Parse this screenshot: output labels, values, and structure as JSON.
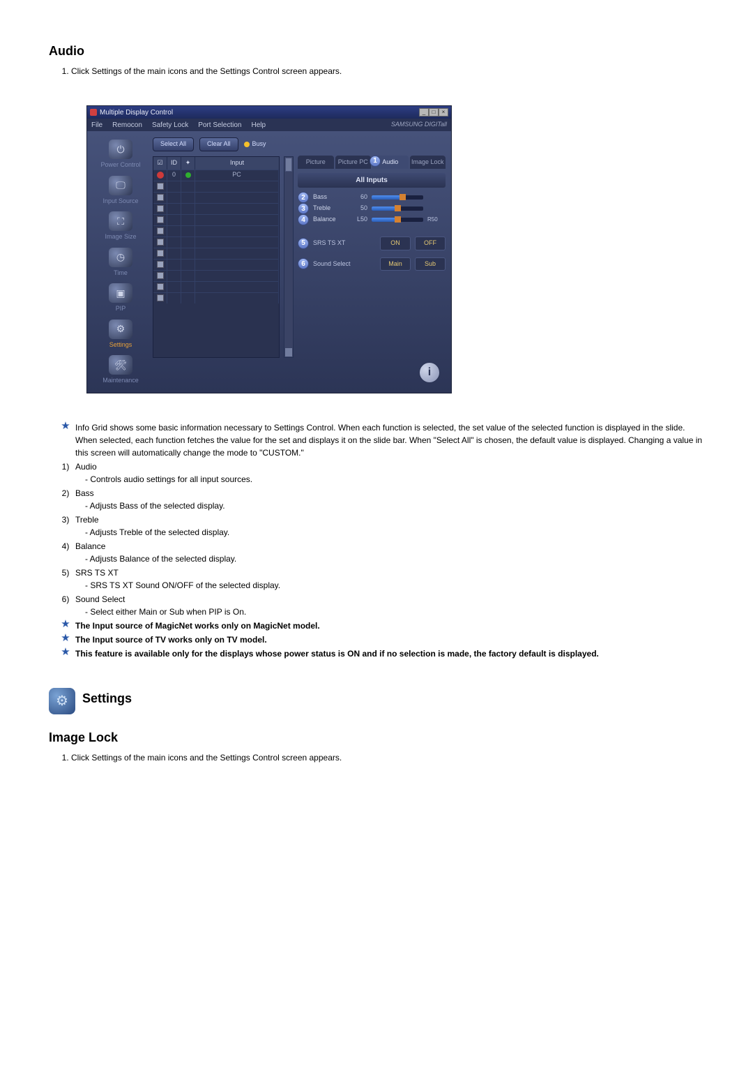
{
  "section1_title": "Audio",
  "section1_step": "Click Settings of the main icons and the Settings Control screen appears.",
  "app": {
    "window_title": "Multiple Display Control",
    "win_min": "_",
    "win_max": "□",
    "win_close": "×",
    "menu": [
      "File",
      "Remocon",
      "Safety Lock",
      "Port Selection",
      "Help"
    ],
    "brand": "SAMSUNG DIGITall",
    "sidebar": [
      {
        "label": "Power Control",
        "glyph": "⏻"
      },
      {
        "label": "Input Source",
        "glyph": "🖵"
      },
      {
        "label": "Image Size",
        "glyph": "⛶"
      },
      {
        "label": "Time",
        "glyph": "◷"
      },
      {
        "label": "PIP",
        "glyph": "▣"
      },
      {
        "label": "Settings",
        "glyph": "⚙",
        "active": true
      },
      {
        "label": "Maintenance",
        "glyph": "🛠"
      }
    ],
    "toolbar": {
      "select_all": "Select All",
      "clear_all": "Clear All",
      "busy": "Busy"
    },
    "grid": {
      "headers": {
        "chk": "☑",
        "id": "ID",
        "status": "✦",
        "input": "Input"
      },
      "row0": {
        "id": "0",
        "input": "PC"
      },
      "blank_rows": 11
    },
    "tabs": {
      "picture": "Picture",
      "picture_pc": "Picture PC",
      "audio": "Audio",
      "image_lock": "Image Lock",
      "audio_badge": "1"
    },
    "panel_head": "All Inputs",
    "sliders": [
      {
        "n": "2",
        "label": "Bass",
        "value": "60",
        "pct": 60
      },
      {
        "n": "3",
        "label": "Treble",
        "value": "50",
        "pct": 50
      },
      {
        "n": "4",
        "label": "Balance",
        "value": "L50",
        "right": "R50",
        "pct": 50
      }
    ],
    "toggles": [
      {
        "n": "5",
        "label": "SRS TS XT",
        "a": "ON",
        "b": "OFF"
      },
      {
        "n": "6",
        "label": "Sound Select",
        "a": "Main",
        "b": "Sub"
      }
    ],
    "info_glyph": "i"
  },
  "notes": {
    "info_grid": "Info Grid shows some basic information necessary to Settings Control. When each function is selected, the set value of the selected function is displayed in the slide. When selected, each function fetches the value for the set and displays it on the slide bar. When \"Select All\" is chosen, the default value is displayed. Changing a value in this screen will automatically change the mode to \"CUSTOM.\"",
    "items": [
      {
        "n": "1)",
        "t": "Audio",
        "d": "- Controls audio settings for all input sources."
      },
      {
        "n": "2)",
        "t": "Bass",
        "d": "- Adjusts Bass of the selected display."
      },
      {
        "n": "3)",
        "t": "Treble",
        "d": "- Adjusts Treble of the selected display."
      },
      {
        "n": "4)",
        "t": "Balance",
        "d": "- Adjusts Balance of the selected display."
      },
      {
        "n": "5)",
        "t": "SRS TS XT",
        "d": "- SRS TS XT Sound ON/OFF of the selected display."
      },
      {
        "n": "6)",
        "t": "Sound Select",
        "d": "- Select either Main or Sub when PIP is On."
      }
    ],
    "bold1": "The Input source of MagicNet works only on MagicNet model.",
    "bold2": "The Input source of TV works only on TV model.",
    "bold3": "This feature is available only for the displays whose power status is ON and if no selection is made, the factory default is displayed."
  },
  "settings_heading": "Settings",
  "section2_title": "Image Lock",
  "section2_step": "Click Settings of the main icons and the Settings Control screen appears."
}
